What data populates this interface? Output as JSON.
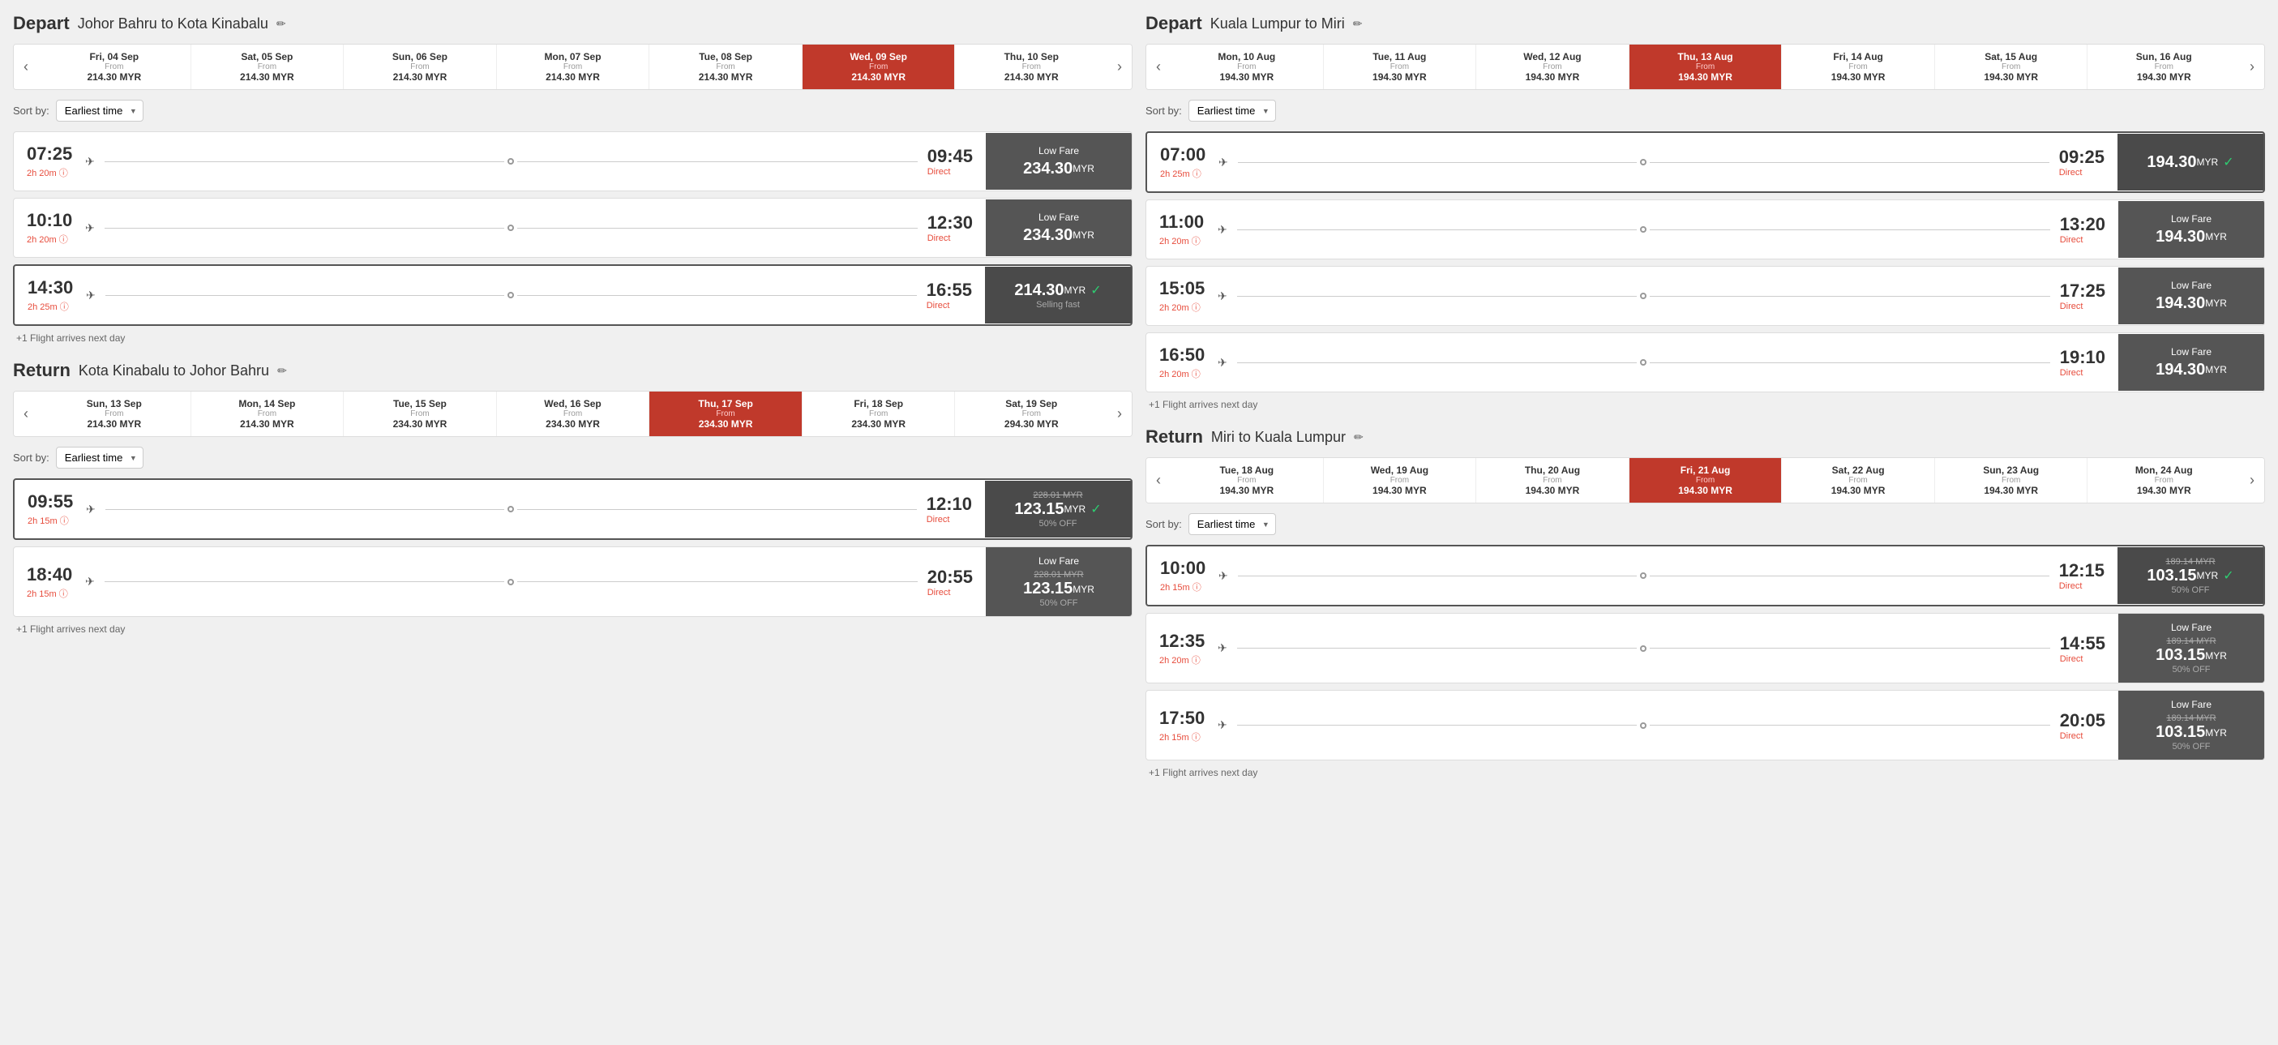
{
  "left": {
    "depart": {
      "title": "Depart",
      "route": "Johor Bahru to Kota Kinabalu",
      "dates": [
        {
          "label": "Fri, 04 Sep",
          "from": "From",
          "price": "214.30 MYR",
          "selected": false
        },
        {
          "label": "Sat, 05 Sep",
          "from": "From",
          "price": "214.30 MYR",
          "selected": false
        },
        {
          "label": "Sun, 06 Sep",
          "from": "From",
          "price": "214.30 MYR",
          "selected": false
        },
        {
          "label": "Mon, 07 Sep",
          "from": "From",
          "price": "214.30 MYR",
          "selected": false
        },
        {
          "label": "Tue, 08 Sep",
          "from": "From",
          "price": "214.30 MYR",
          "selected": false
        },
        {
          "label": "Wed, 09 Sep",
          "from": "From",
          "price": "214.30 MYR",
          "selected": true
        },
        {
          "label": "Thu, 10 Sep",
          "from": "From",
          "price": "214.30 MYR",
          "selected": false
        }
      ],
      "sort_label": "Sort by:",
      "sort_value": "Earliest time",
      "flights": [
        {
          "depart": "07:25",
          "duration": "2h 20m",
          "arrive": "09:45",
          "direct": "Direct",
          "fare_label": "Low Fare",
          "price": "234.30",
          "currency": "MYR",
          "selected": false,
          "selling_fast": false,
          "old_price": null,
          "discount": null
        },
        {
          "depart": "10:10",
          "duration": "2h 20m",
          "arrive": "12:30",
          "direct": "Direct",
          "fare_label": "Low Fare",
          "price": "234.30",
          "currency": "MYR",
          "selected": false,
          "selling_fast": false,
          "old_price": null,
          "discount": null
        },
        {
          "depart": "14:30",
          "duration": "2h 25m",
          "arrive": "16:55",
          "direct": "Direct",
          "fare_label": "",
          "price": "214.30",
          "currency": "MYR",
          "selected": true,
          "selling_fast": true,
          "old_price": null,
          "discount": null
        }
      ],
      "next_day_note": "+1 Flight arrives next day"
    },
    "return": {
      "title": "Return",
      "route": "Kota Kinabalu to Johor Bahru",
      "dates": [
        {
          "label": "Sun, 13 Sep",
          "from": "From",
          "price": "214.30 MYR",
          "selected": false
        },
        {
          "label": "Mon, 14 Sep",
          "from": "From",
          "price": "214.30 MYR",
          "selected": false
        },
        {
          "label": "Tue, 15 Sep",
          "from": "From",
          "price": "234.30 MYR",
          "selected": false
        },
        {
          "label": "Wed, 16 Sep",
          "from": "From",
          "price": "234.30 MYR",
          "selected": false
        },
        {
          "label": "Thu, 17 Sep",
          "from": "From",
          "price": "234.30 MYR",
          "selected": true
        },
        {
          "label": "Fri, 18 Sep",
          "from": "From",
          "price": "234.30 MYR",
          "selected": false
        },
        {
          "label": "Sat, 19 Sep",
          "from": "From",
          "price": "294.30 MYR",
          "selected": false
        }
      ],
      "sort_label": "Sort by:",
      "sort_value": "Earliest time",
      "flights": [
        {
          "depart": "09:55",
          "duration": "2h 15m",
          "arrive": "12:10",
          "direct": "Direct",
          "fare_label": "",
          "price": "123.15",
          "currency": "MYR",
          "selected": true,
          "selling_fast": false,
          "old_price": "228.01 MYR",
          "discount": "50% OFF"
        },
        {
          "depart": "18:40",
          "duration": "2h 15m",
          "arrive": "20:55",
          "direct": "Direct",
          "fare_label": "Low Fare",
          "price": "123.15",
          "currency": "MYR",
          "selected": false,
          "selling_fast": false,
          "old_price": "228.01 MYR",
          "discount": "50% OFF"
        }
      ],
      "next_day_note": "+1 Flight arrives next day"
    }
  },
  "right": {
    "depart": {
      "title": "Depart",
      "route": "Kuala Lumpur to Miri",
      "dates": [
        {
          "label": "Mon, 10 Aug",
          "from": "From",
          "price": "194.30 MYR",
          "selected": false
        },
        {
          "label": "Tue, 11 Aug",
          "from": "From",
          "price": "194.30 MYR",
          "selected": false
        },
        {
          "label": "Wed, 12 Aug",
          "from": "From",
          "price": "194.30 MYR",
          "selected": false
        },
        {
          "label": "Thu, 13 Aug",
          "from": "From",
          "price": "194.30 MYR",
          "selected": true
        },
        {
          "label": "Fri, 14 Aug",
          "from": "From",
          "price": "194.30 MYR",
          "selected": false
        },
        {
          "label": "Sat, 15 Aug",
          "from": "From",
          "price": "194.30 MYR",
          "selected": false
        },
        {
          "label": "Sun, 16 Aug",
          "from": "From",
          "price": "194.30 MYR",
          "selected": false
        }
      ],
      "sort_label": "Sort by:",
      "sort_value": "Earliest time",
      "flights": [
        {
          "depart": "07:00",
          "duration": "2h 25m",
          "arrive": "09:25",
          "direct": "Direct",
          "fare_label": "",
          "price": "194.30",
          "currency": "MYR",
          "selected": true,
          "selling_fast": false,
          "old_price": null,
          "discount": null
        },
        {
          "depart": "11:00",
          "duration": "2h 20m",
          "arrive": "13:20",
          "direct": "Direct",
          "fare_label": "Low Fare",
          "price": "194.30",
          "currency": "MYR",
          "selected": false,
          "selling_fast": false,
          "old_price": null,
          "discount": null
        },
        {
          "depart": "15:05",
          "duration": "2h 20m",
          "arrive": "17:25",
          "direct": "Direct",
          "fare_label": "Low Fare",
          "price": "194.30",
          "currency": "MYR",
          "selected": false,
          "selling_fast": false,
          "old_price": null,
          "discount": null
        },
        {
          "depart": "16:50",
          "duration": "2h 20m",
          "arrive": "19:10",
          "direct": "Direct",
          "fare_label": "Low Fare",
          "price": "194.30",
          "currency": "MYR",
          "selected": false,
          "selling_fast": false,
          "old_price": null,
          "discount": null
        }
      ],
      "next_day_note": "+1 Flight arrives next day"
    },
    "return": {
      "title": "Return",
      "route": "Miri to Kuala Lumpur",
      "dates": [
        {
          "label": "Tue, 18 Aug",
          "from": "From",
          "price": "194.30 MYR",
          "selected": false
        },
        {
          "label": "Wed, 19 Aug",
          "from": "From",
          "price": "194.30 MYR",
          "selected": false
        },
        {
          "label": "Thu, 20 Aug",
          "from": "From",
          "price": "194.30 MYR",
          "selected": false
        },
        {
          "label": "Fri, 21 Aug",
          "from": "From",
          "price": "194.30 MYR",
          "selected": true
        },
        {
          "label": "Sat, 22 Aug",
          "from": "From",
          "price": "194.30 MYR",
          "selected": false
        },
        {
          "label": "Sun, 23 Aug",
          "from": "From",
          "price": "194.30 MYR",
          "selected": false
        },
        {
          "label": "Mon, 24 Aug",
          "from": "From",
          "price": "194.30 MYR",
          "selected": false
        }
      ],
      "sort_label": "Sort by:",
      "sort_value": "Earliest time",
      "flights": [
        {
          "depart": "10:00",
          "duration": "2h 15m",
          "arrive": "12:15",
          "direct": "Direct",
          "fare_label": "",
          "price": "103.15",
          "currency": "MYR",
          "selected": true,
          "selling_fast": false,
          "old_price": "189.14 MYR",
          "discount": "50% OFF"
        },
        {
          "depart": "12:35",
          "duration": "2h 20m",
          "arrive": "14:55",
          "direct": "Direct",
          "fare_label": "Low Fare",
          "price": "103.15",
          "currency": "MYR",
          "selected": false,
          "selling_fast": false,
          "old_price": "189.14 MYR",
          "discount": "50% OFF"
        },
        {
          "depart": "17:50",
          "duration": "2h 15m",
          "arrive": "20:05",
          "direct": "Direct",
          "fare_label": "Low Fare",
          "price": "103.15",
          "currency": "MYR",
          "selected": false,
          "selling_fast": false,
          "old_price": "189.14 MYR",
          "discount": "50% OFF"
        }
      ],
      "next_day_note": "+1 Flight arrives next day"
    }
  }
}
